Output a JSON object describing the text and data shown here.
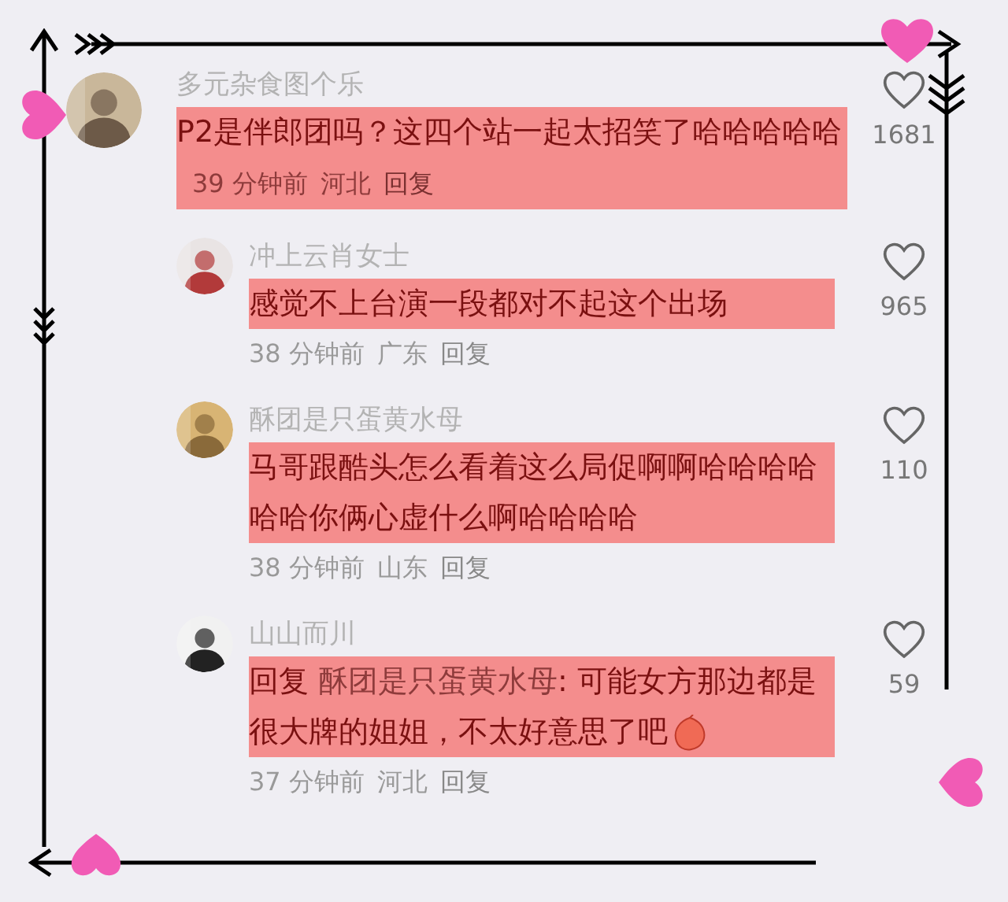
{
  "comments": [
    {
      "kind": "top",
      "user": "多元杂食图个乐",
      "text": "P2是伴郎团吗？这四个站一起太招笑了哈哈哈哈哈",
      "time": "39 分钟前",
      "region": "河北",
      "reply": "回复",
      "likes": "1681",
      "liked": false,
      "highlighted": true
    },
    {
      "kind": "reply",
      "user": "冲上云肖女士",
      "text": "感觉不上台演一段都对不起这个出场",
      "time": "38 分钟前",
      "region": "广东",
      "reply": "回复",
      "likes": "965",
      "liked": false,
      "highlighted": true
    },
    {
      "kind": "reply",
      "user": "酥团是只蛋黄水母",
      "text": "马哥跟酷头怎么看着这么局促啊啊哈哈哈哈哈哈你俩心虚什么啊哈哈哈哈",
      "time": "38 分钟前",
      "region": "山东",
      "reply": "回复",
      "likes": "110",
      "liked": false,
      "highlighted": true
    },
    {
      "kind": "reply",
      "user": "山山而川",
      "reply_label": "回复",
      "reply_to": "酥团是只蛋黄水母",
      "text": ": 可能女方那边都是很大牌的姐姐，不太好意思了吧",
      "sticker": true,
      "time": "37 分钟前",
      "region": "河北",
      "reply": "回复",
      "likes": "59",
      "liked": false,
      "highlighted": true
    }
  ]
}
